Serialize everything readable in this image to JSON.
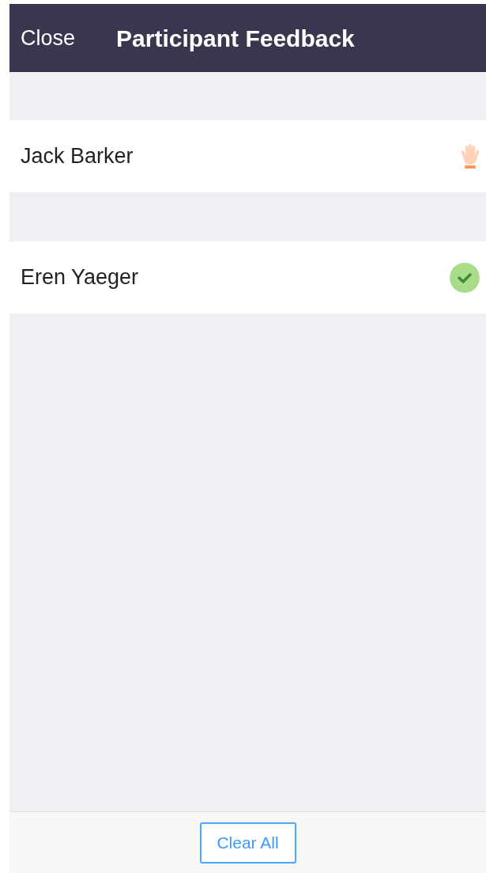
{
  "header": {
    "close": "Close",
    "title": "Participant Feedback"
  },
  "participants": [
    {
      "name": "Jack Barker",
      "kind": "hand"
    },
    {
      "name": "Eren Yaeger",
      "kind": "check"
    }
  ],
  "footer": {
    "button": "Clear All"
  }
}
